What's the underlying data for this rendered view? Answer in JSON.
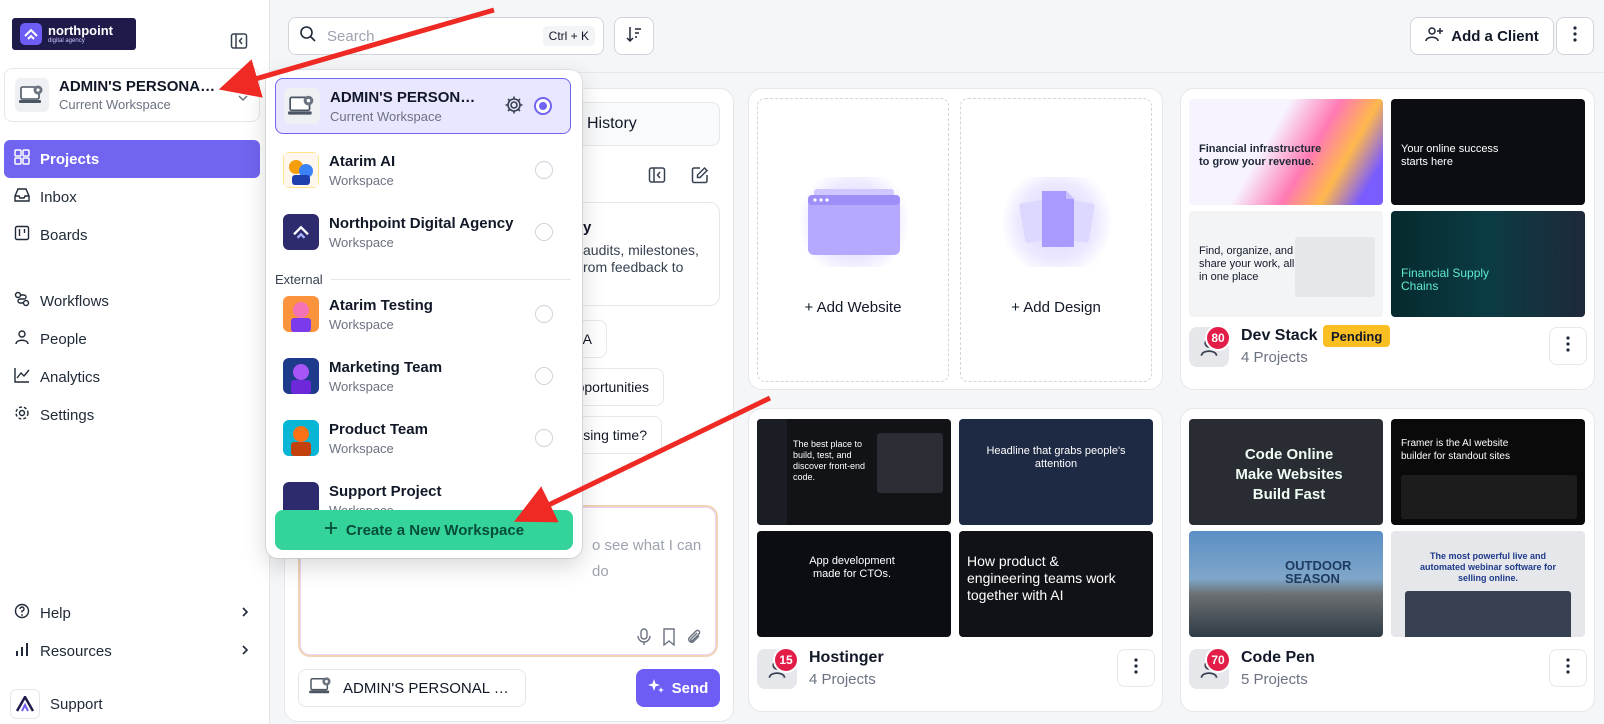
{
  "brand": {
    "name": "northpoint",
    "tagline": "digital agency"
  },
  "workspace": {
    "name": "ADMIN'S PERSONAL WORKSPACE",
    "subtitle": "Current Workspace"
  },
  "nav": {
    "projects": "Projects",
    "inbox": "Inbox",
    "boards": "Boards",
    "workflows": "Workflows",
    "people": "People",
    "analytics": "Analytics",
    "settings": "Settings",
    "help": "Help",
    "resources": "Resources",
    "support": "Support"
  },
  "search": {
    "placeholder": "Search",
    "shortcut": "Ctrl + K"
  },
  "header": {
    "add_client": "Add a Client"
  },
  "chat": {
    "history": "History",
    "intro_title": "y",
    "intro_text": "audits, milestones, rom feedback to",
    "chips": [
      "QA",
      "pportunities",
      "osing time?"
    ],
    "prompt_placeholder": "o see what I can do",
    "workspace_select": "ADMIN'S PERSONAL WORKSPACE",
    "send": "Send"
  },
  "add": {
    "website": "Add Website",
    "design": "Add Design"
  },
  "clients": [
    {
      "name": "Dev Stack",
      "projects": "4 Projects",
      "count": "80",
      "status": "Pending"
    },
    {
      "name": "Hostinger",
      "projects": "4 Projects",
      "count": "15"
    },
    {
      "name": "Code Pen",
      "projects": "5 Projects",
      "count": "70"
    }
  ],
  "thumbs": {
    "a1": "Financial infrastructure to grow your revenue.",
    "a2": "Your online success starts here",
    "a3": "Find, organize, and share your work, all in one place",
    "a4": "Financial Supply Chains",
    "b1": "The best place to build, test, and discover front-end code.",
    "b2": "Headline that grabs people's attention",
    "b3": "App development made for CTOs.",
    "b4": "How product & engineering teams work together with AI",
    "c1": "Code Online Make Websites Build Fast",
    "c2": "Framer is the AI website builder for standout sites",
    "c3": "OUTDOOR SEASON",
    "c4": "The most powerful live and automated webinar software for selling online."
  },
  "dropdown": {
    "items": [
      {
        "name": "ADMIN'S PERSONAL WORKSPACE",
        "sub": "Current Workspace"
      },
      {
        "name": "Atarim AI",
        "sub": "Workspace"
      },
      {
        "name": "Northpoint Digital Agency",
        "sub": "Workspace"
      },
      {
        "name": "Atarim Testing",
        "sub": "Workspace"
      },
      {
        "name": "Marketing Team",
        "sub": "Workspace"
      },
      {
        "name": "Product Team",
        "sub": "Workspace"
      },
      {
        "name": "Support Project",
        "sub": "Workspace"
      }
    ],
    "external_label": "External",
    "create": "Create a New Workspace"
  },
  "colors": {
    "accent": "#7164f0",
    "create": "#34d399",
    "badge": "#e11d48",
    "pending": "#fbbf24",
    "arrow": "#ef2a24"
  }
}
